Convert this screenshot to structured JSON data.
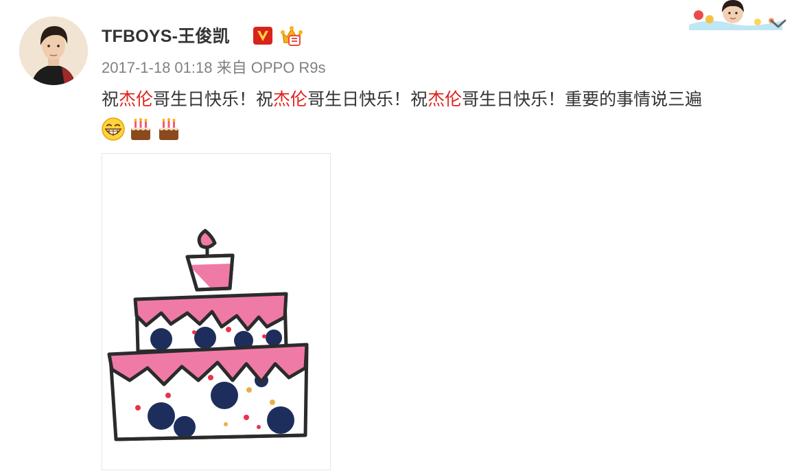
{
  "post": {
    "username": "TFBOYS-王俊凯",
    "timestamp": "2017-1-18 01:18",
    "source_prefix": "来自",
    "source": "OPPO R9s",
    "text_parts": [
      {
        "text": "祝",
        "highlight": false
      },
      {
        "text": "杰伦",
        "highlight": true
      },
      {
        "text": "哥生日快乐！祝",
        "highlight": false
      },
      {
        "text": "杰伦",
        "highlight": true
      },
      {
        "text": "哥生日快乐！祝",
        "highlight": false
      },
      {
        "text": "杰伦",
        "highlight": true
      },
      {
        "text": "哥生日快乐！重要的事情说三遍",
        "highlight": false
      }
    ],
    "emojis": [
      "grin-emoji",
      "cake-emoji",
      "cake-emoji"
    ],
    "badges": [
      "verified-v-icon",
      "member-crown-icon"
    ],
    "image_alt": "birthday-cake-drawing"
  },
  "colors": {
    "highlight": "#e0201c",
    "meta_gray": "#808080",
    "text": "#333333",
    "cake_pink": "#f06aa0",
    "cake_navy": "#1e2e5c"
  }
}
